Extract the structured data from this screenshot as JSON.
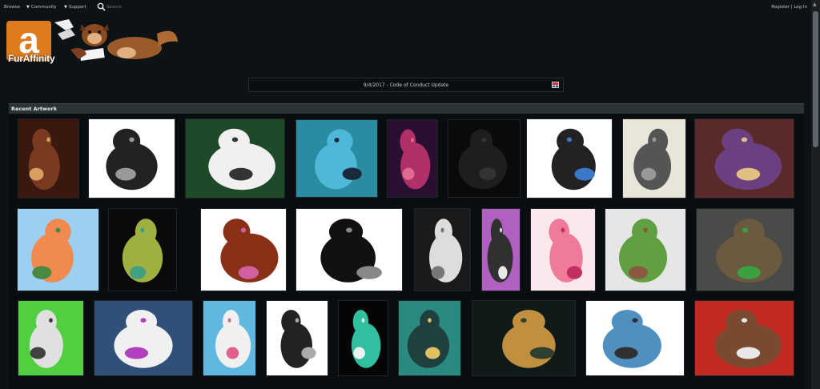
{
  "nav": {
    "browse": "Browse",
    "community": "Community",
    "support": "Support",
    "search_placeholder": "Search",
    "register": "Register",
    "separator": " | ",
    "login": "Log In"
  },
  "logo": {
    "text": "FurAffinity",
    "icon": "mascot-logo"
  },
  "announcement": {
    "text": "9/4/2017 - Code of Conduct Update",
    "icon": "notice-icon"
  },
  "section": {
    "title": "Recent Artwork"
  },
  "colors": {
    "background": "#0d1214",
    "section_bar": "#2c3337",
    "logo_orange": "#e07a1f"
  },
  "gallery": {
    "rows": [
      [
        {
          "bg": "#3a1810",
          "fg": "#7a3a20",
          "accent": "#d8a060"
        },
        {
          "bg": "#ffffff",
          "fg": "#222222",
          "accent": "#999999"
        },
        {
          "bg": "#1f4a2a",
          "fg": "#f0f0f0",
          "accent": "#333333"
        },
        {
          "bg": "#2a8ca0",
          "fg": "#4fb8d8",
          "accent": "#1a2a3a"
        },
        {
          "bg": "#2a1030",
          "fg": "#b0306a",
          "accent": "#e06a90"
        },
        {
          "bg": "#0a0a0a",
          "fg": "#1e1e1e",
          "accent": "#333333"
        },
        {
          "bg": "#ffffff",
          "fg": "#222222",
          "accent": "#3a78c8"
        },
        {
          "bg": "#e8e6d8",
          "fg": "#555555",
          "accent": "#999999"
        },
        {
          "bg": "#5a2a2a",
          "fg": "#6a4080",
          "accent": "#e0c080"
        }
      ],
      [
        {
          "bg": "#9ccff0",
          "fg": "#f08a50",
          "accent": "#4a8a40"
        },
        {
          "bg": "#0a0a0a",
          "fg": "#a0b040",
          "accent": "#40a080"
        },
        {
          "bg": "#ffffff",
          "fg": "#8a3018",
          "accent": "#d060a0"
        },
        {
          "bg": "#ffffff",
          "fg": "#111111",
          "accent": "#888888"
        },
        {
          "bg": "#1a1a1a",
          "fg": "#dddddd",
          "accent": "#777777"
        },
        {
          "bg": "#b060c0",
          "fg": "#303030",
          "accent": "#e8e8e8"
        },
        {
          "bg": "#fbe8ec",
          "fg": "#f07a9a",
          "accent": "#c03060"
        },
        {
          "bg": "#e6e6e6",
          "fg": "#60a040",
          "accent": "#8a5a40"
        },
        {
          "bg": "#4a4a48",
          "fg": "#6a5a40",
          "accent": "#3aa040"
        }
      ],
      [
        {
          "bg": "#50d040",
          "fg": "#e0e0e0",
          "accent": "#404040"
        },
        {
          "bg": "#30507a",
          "fg": "#f0f0f0",
          "accent": "#b040c0"
        },
        {
          "bg": "#60b8e0",
          "fg": "#f0f0f0",
          "accent": "#e06090"
        },
        {
          "bg": "#ffffff",
          "fg": "#222222",
          "accent": "#aaaaaa"
        },
        {
          "bg": "#050505",
          "fg": "#30c0a0",
          "accent": "#f0f0f0"
        },
        {
          "bg": "#2a8a80",
          "fg": "#204040",
          "accent": "#e0c060"
        },
        {
          "bg": "#101a18",
          "fg": "#c09040",
          "accent": "#304030"
        },
        {
          "bg": "#ffffff",
          "fg": "#5090c0",
          "accent": "#303030"
        },
        {
          "bg": "#c02a20",
          "fg": "#7a4a30",
          "accent": "#e8e8e8"
        }
      ]
    ]
  }
}
